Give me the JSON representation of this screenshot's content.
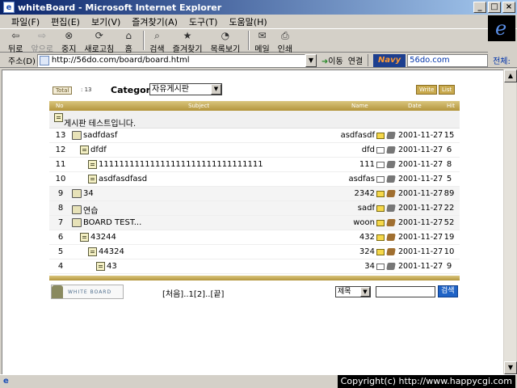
{
  "window": {
    "title": "whiteBoard - Microsoft Internet Explorer",
    "buttons": [
      "_",
      "□",
      "×"
    ]
  },
  "menu": [
    "파일(F)",
    "편집(E)",
    "보기(V)",
    "즐겨찾기(A)",
    "도구(T)",
    "도움말(H)"
  ],
  "toolbar": {
    "back": "뒤로",
    "forward": "앞으로",
    "stop": "중지",
    "refresh": "새로고침",
    "home": "홈",
    "search": "검색",
    "favorites": "즐겨찾기",
    "history": "목록보기",
    "mail": "메일",
    "print": "인쇄"
  },
  "address": {
    "label": "주소(D)",
    "url": "http://56do.com/board/board.html",
    "go": "이동",
    "links": "연결",
    "navy_logo": "Navy",
    "navy_field": "56do.com",
    "navy_all": "전체:"
  },
  "board": {
    "total_label": "Total",
    "total_count": ": 13",
    "category_label": "Category",
    "category_value": "자유게시판",
    "write_btn": "Write",
    "list_btn": "List",
    "headers": {
      "no": "No",
      "subject": "Subject",
      "name": "Name",
      "date": "Date",
      "hit": "Hit"
    },
    "notice": "게시판 테스트입니다.",
    "rows": [
      {
        "no": "13",
        "subject": "sadfdasf",
        "name": "asdfasdf",
        "date": "2001-11-27",
        "hit": "15",
        "depth": 0,
        "icon": "folder",
        "mail": "yellow",
        "cube": "gray"
      },
      {
        "no": "12",
        "subject": "dfdf",
        "name": "dfd",
        "date": "2001-11-27",
        "hit": "6",
        "depth": 1,
        "icon": "doc",
        "mail": "white",
        "cube": "gray"
      },
      {
        "no": "11",
        "subject": "11111111111111111111111111111111",
        "name": "111",
        "date": "2001-11-27",
        "hit": "8",
        "depth": 2,
        "icon": "doc",
        "mail": "white",
        "cube": "gray"
      },
      {
        "no": "10",
        "subject": "asdfasdfasd",
        "name": "asdfas",
        "date": "2001-11-27",
        "hit": "5",
        "depth": 2,
        "icon": "doc",
        "mail": "white",
        "cube": "gray"
      },
      {
        "no": "9",
        "subject": "34",
        "name": "2342",
        "date": "2001-11-27",
        "hit": "89",
        "depth": 0,
        "icon": "folder",
        "mail": "yellow",
        "cube": "brown"
      },
      {
        "no": "8",
        "subject": "연습",
        "name": "sadf",
        "date": "2001-11-27",
        "hit": "22",
        "depth": 0,
        "icon": "folder",
        "mail": "yellow",
        "cube": "gray"
      },
      {
        "no": "7",
        "subject": "BOARD TEST...",
        "name": "woon",
        "date": "2001-11-27",
        "hit": "52",
        "depth": 0,
        "icon": "folder",
        "mail": "yellow",
        "cube": "brown"
      },
      {
        "no": "6",
        "subject": "43244",
        "name": "432",
        "date": "2001-11-27",
        "hit": "19",
        "depth": 1,
        "icon": "doc",
        "mail": "yellow",
        "cube": "brown"
      },
      {
        "no": "5",
        "subject": "44324",
        "name": "324",
        "date": "2001-11-27",
        "hit": "10",
        "depth": 2,
        "icon": "doc",
        "mail": "yellow",
        "cube": "brown"
      },
      {
        "no": "4",
        "subject": "43",
        "name": "34",
        "date": "2001-11-27",
        "hit": "9",
        "depth": 3,
        "icon": "doc",
        "mail": "white",
        "cube": "gray"
      }
    ],
    "logo_text": "WHITE BOARD",
    "pager": "[처음]..1[2]..[끝]",
    "search_field": "제목",
    "search_btn": "검색"
  },
  "status": {
    "copyright": "Copyright(c) http://www.happycgi.com"
  }
}
